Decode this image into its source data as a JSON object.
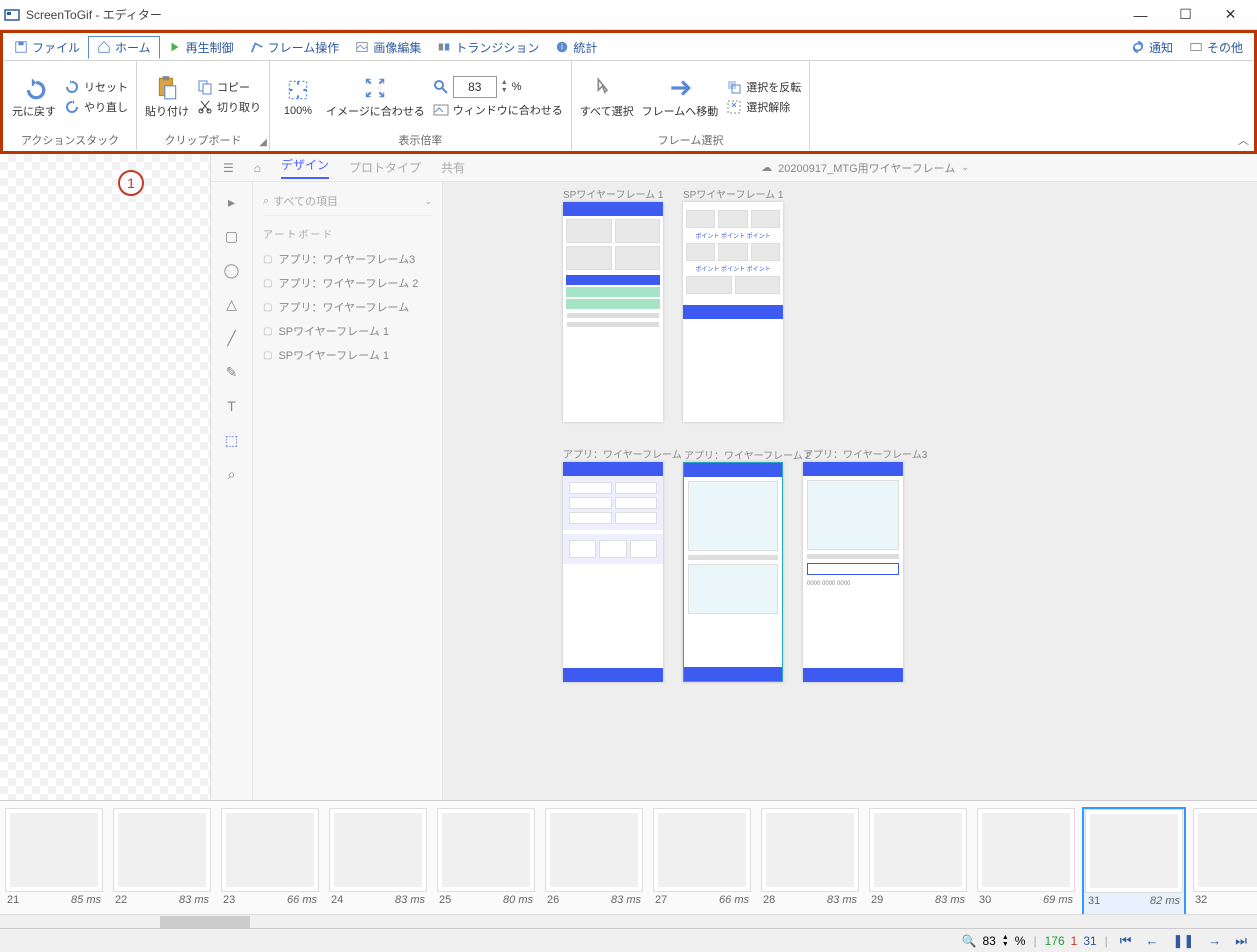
{
  "window": {
    "title": "ScreenToGif - エディター"
  },
  "menu": {
    "file": "ファイル",
    "home": "ホーム",
    "playback": "再生制御",
    "frame": "フレーム操作",
    "image": "画像編集",
    "transition": "トランジション",
    "stats": "統計",
    "notify": "通知",
    "other": "その他"
  },
  "ribbon": {
    "undo": "元に戻す",
    "reset": "リセット",
    "redo": "やり直し",
    "group_action": "アクションスタック",
    "paste": "貼り付け",
    "copy": "コピー",
    "cut": "切り取り",
    "group_clipboard": "クリップボード",
    "zoom_100": "100%",
    "fit_image": "イメージに合わせる",
    "zoom_value": "83",
    "zoom_pct": "%",
    "fit_window": "ウィンドウに合わせる",
    "group_zoom": "表示倍率",
    "select_all": "すべて選択",
    "goto_frame": "フレームへ移動",
    "invert_sel": "選択を反転",
    "clear_sel": "選択解除",
    "group_select": "フレーム選択"
  },
  "annotation": "1",
  "inner": {
    "tabs": {
      "design": "デザイン",
      "prototype": "プロトタイプ",
      "share": "共有"
    },
    "doc_title": "20200917_MTG用ワイヤーフレーム",
    "search": "すべての項目",
    "section": "アートボード",
    "layers": [
      "アプリ：ワイヤーフレーム3",
      "アプリ：ワイヤーフレーム 2",
      "アプリ：ワイヤーフレーム",
      "SPワイヤーフレーム 1",
      "SPワイヤーフレーム 1"
    ],
    "artboards": {
      "sp1": "SPワイヤーフレーム 1",
      "sp2": "SPワイヤーフレーム 1",
      "app1": "アプリ：ワイヤーフレーム",
      "app2": "アプリ：ワイヤーフレーム 2",
      "app3": "アプリ：ワイヤーフレーム3"
    }
  },
  "timeline": {
    "frames": [
      {
        "num": "21",
        "dur": "85 ms"
      },
      {
        "num": "22",
        "dur": "83 ms"
      },
      {
        "num": "23",
        "dur": "66 ms"
      },
      {
        "num": "24",
        "dur": "83 ms"
      },
      {
        "num": "25",
        "dur": "80 ms"
      },
      {
        "num": "26",
        "dur": "83 ms"
      },
      {
        "num": "27",
        "dur": "66 ms"
      },
      {
        "num": "28",
        "dur": "83 ms"
      },
      {
        "num": "29",
        "dur": "83 ms"
      },
      {
        "num": "30",
        "dur": "69 ms"
      },
      {
        "num": "31",
        "dur": "82 ms",
        "selected": true
      },
      {
        "num": "32",
        "dur": ""
      }
    ]
  },
  "statusbar": {
    "zoom": "83",
    "pct": "%",
    "total": "176",
    "selected": "1",
    "current": "31"
  }
}
